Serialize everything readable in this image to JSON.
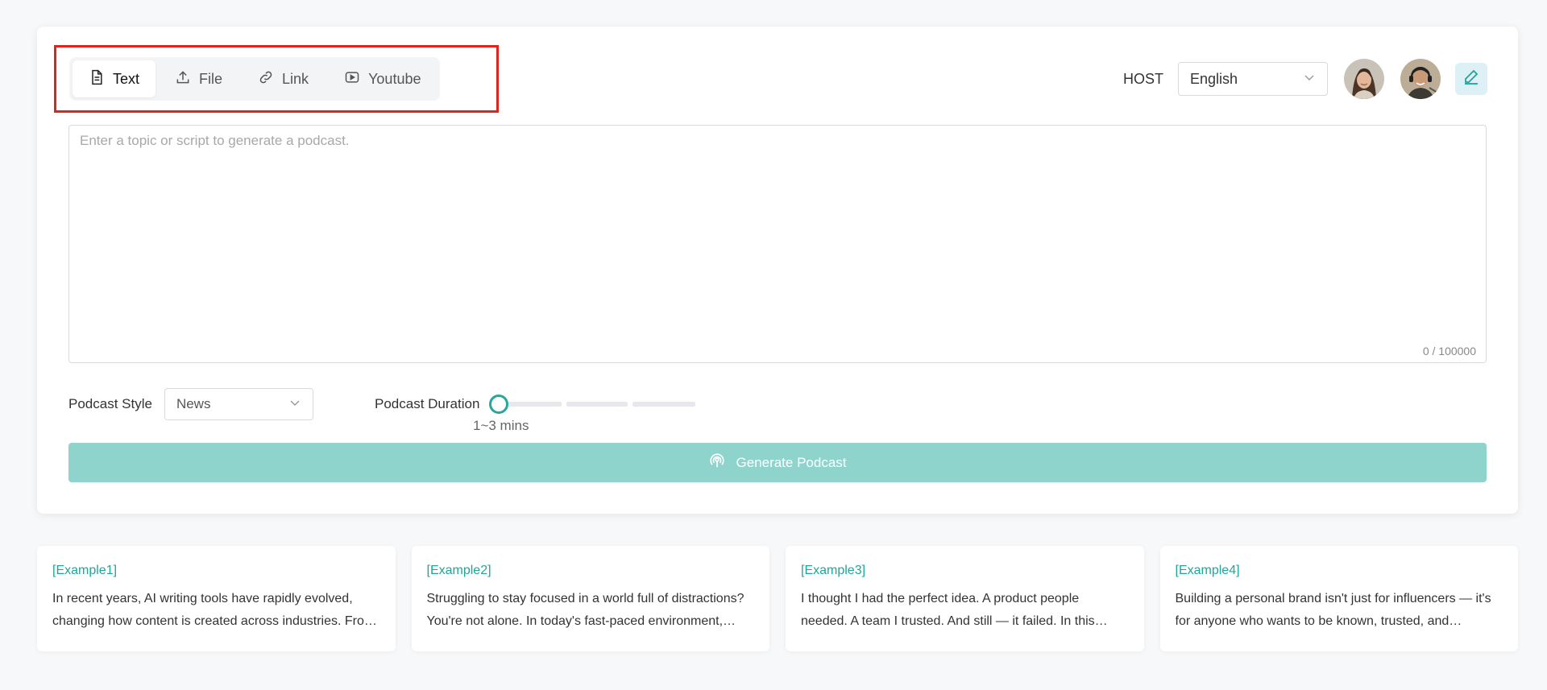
{
  "tabs": [
    {
      "label": "Text",
      "icon": "document-icon",
      "active": true
    },
    {
      "label": "File",
      "icon": "upload-icon",
      "active": false
    },
    {
      "label": "Link",
      "icon": "link-icon",
      "active": false
    },
    {
      "label": "Youtube",
      "icon": "youtube-icon",
      "active": false
    }
  ],
  "host": {
    "label": "HOST",
    "language": "English"
  },
  "input": {
    "placeholder": "Enter a topic or script to generate a podcast.",
    "value": "",
    "counter": "0 / 100000"
  },
  "style": {
    "label": "Podcast Style",
    "value": "News"
  },
  "duration": {
    "label": "Podcast Duration",
    "value_text": "1~3 mins"
  },
  "generate": {
    "label": "Generate Podcast"
  },
  "examples": [
    {
      "title": "[Example1]",
      "text": "In recent years, AI writing tools have rapidly evolved, changing how content is created across industries. From marketing copy to long-form articles and scripts, these tools..."
    },
    {
      "title": "[Example2]",
      "text": "Struggling to stay focused in a world full of distractions? You're not alone. In today's fast-paced environment, notifications, endless tabs and multitasking..."
    },
    {
      "title": "[Example3]",
      "text": "I thought I had the perfect idea. A product people needed. A team I trusted. And still — it failed. In this episode I look back at what went wrong..."
    },
    {
      "title": "[Example4]",
      "text": "Building a personal brand isn't just for influencers — it's for anyone who wants to be known, trusted, and remembered in their field..."
    }
  ],
  "colors": {
    "accent": "#1fa59a",
    "button_disabled": "#8ed4cd",
    "highlight": "#e0241c"
  }
}
